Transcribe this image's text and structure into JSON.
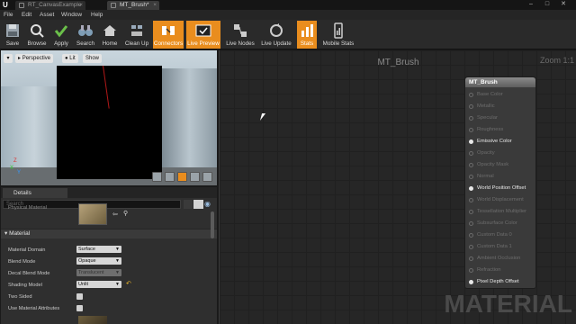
{
  "tabs": [
    {
      "label": "RT_CanvasExample"
    },
    {
      "label": "MT_Brush*"
    }
  ],
  "window_controls": {
    "minimize": "–",
    "maximize": "□",
    "close": "✕"
  },
  "menu": {
    "items": [
      "File",
      "Edit",
      "Asset",
      "Window",
      "Help"
    ]
  },
  "toolbar": {
    "buttons": [
      {
        "label": "Save",
        "icon": "save-icon",
        "active": false
      },
      {
        "label": "Browse",
        "icon": "browse-icon",
        "active": false
      },
      {
        "label": "Apply",
        "icon": "apply-icon",
        "active": false
      },
      {
        "label": "Search",
        "icon": "binoculars-icon",
        "active": false
      },
      {
        "label": "Home",
        "icon": "home-icon",
        "active": false
      },
      {
        "label": "Clean Up",
        "icon": "clean-up-icon",
        "active": false
      },
      {
        "label": "Connectors",
        "icon": "connectors-icon",
        "active": true
      },
      {
        "label": "Live Preview",
        "icon": "live-preview-icon",
        "active": true
      },
      {
        "label": "Live Nodes",
        "icon": "live-nodes-icon",
        "active": false
      },
      {
        "label": "Live Update",
        "icon": "live-update-icon",
        "active": false
      },
      {
        "label": "Stats",
        "icon": "stats-icon",
        "active": true
      },
      {
        "label": "Mobile Stats",
        "icon": "mobile-stats-icon",
        "active": false
      }
    ]
  },
  "viewport": {
    "perspective_label": "Perspective",
    "lit_label": "Lit",
    "show_label": "Show",
    "axis_x": "X",
    "axis_y": "Y",
    "axis_z": "Z"
  },
  "details": {
    "tab_label": "Details",
    "search_placeholder": "Search",
    "texture_row_label": "Physical Material",
    "section_title": "Material",
    "properties": [
      {
        "label": "Material Domain",
        "value": "Surface",
        "type": "dropdown",
        "disabled": false
      },
      {
        "label": "Blend Mode",
        "value": "Opaque",
        "type": "dropdown",
        "disabled": false
      },
      {
        "label": "Decal Blend Mode",
        "value": "Translucent",
        "type": "dropdown",
        "disabled": true
      },
      {
        "label": "Shading Model",
        "value": "Unlit",
        "type": "dropdown",
        "disabled": false
      },
      {
        "label": "Two Sided",
        "value": "",
        "type": "checkbox",
        "disabled": false
      },
      {
        "label": "Use Material Attributes",
        "value": "",
        "type": "checkbox",
        "disabled": false
      }
    ]
  },
  "graph": {
    "title": "MT_Brush",
    "zoom": "Zoom 1:1",
    "watermark": "MATERIAL",
    "node": {
      "title": "MT_Brush",
      "pins": [
        {
          "label": "Base Color",
          "active": false
        },
        {
          "label": "Metallic",
          "active": false
        },
        {
          "label": "Specular",
          "active": false
        },
        {
          "label": "Roughness",
          "active": false
        },
        {
          "label": "Emissive Color",
          "active": true
        },
        {
          "label": "Opacity",
          "active": false
        },
        {
          "label": "Opacity Mask",
          "active": false
        },
        {
          "label": "Normal",
          "active": false
        },
        {
          "label": "World Position Offset",
          "active": true
        },
        {
          "label": "World Displacement",
          "active": false
        },
        {
          "label": "Tessellation Multiplier",
          "active": false
        },
        {
          "label": "Subsurface Color",
          "active": false
        },
        {
          "label": "Custom Data 0",
          "active": false
        },
        {
          "label": "Custom Data 1",
          "active": false
        },
        {
          "label": "Ambient Occlusion",
          "active": false
        },
        {
          "label": "Refraction",
          "active": false
        },
        {
          "label": "Pixel Depth Offset",
          "active": true
        }
      ]
    }
  },
  "colors": {
    "accent": "#e98d1e",
    "background": "#262626",
    "panel": "#2f2f2f"
  }
}
